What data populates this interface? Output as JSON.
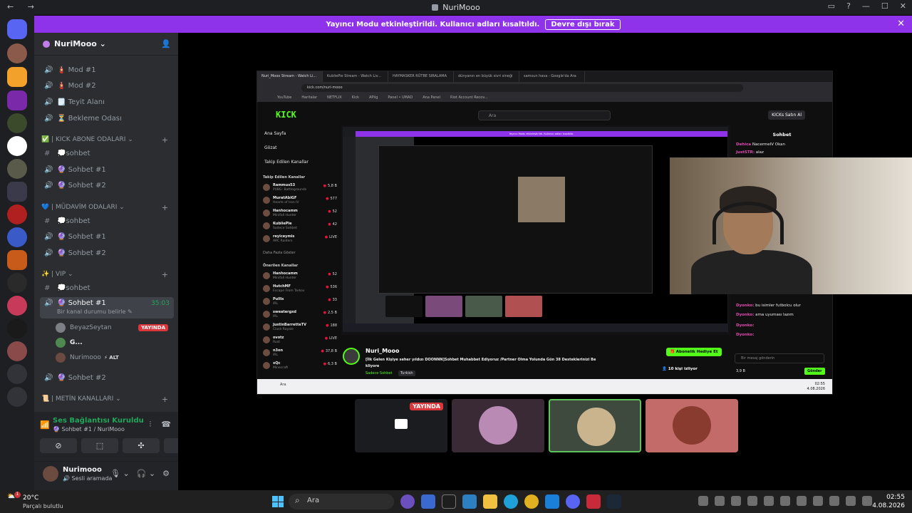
{
  "titlebar": {
    "title": "NuriMooo",
    "nav": "← →",
    "controls": [
      "▭",
      "?",
      "—",
      "☐",
      "✕"
    ]
  },
  "banner": {
    "text": "Yayıncı Modu etkinleştirildi. Kullanıcı adları kısaltıldı.",
    "button": "Devre dışı bırak",
    "close": "✕"
  },
  "server": {
    "name": "NuriMooo ⌄"
  },
  "channels": {
    "top": [
      {
        "icon": "🔊",
        "label": "🧯 Mod #1"
      },
      {
        "icon": "🔊",
        "label": "🧯 Mod #2"
      },
      {
        "icon": "🔊",
        "label": "🗒️ Teyit Alanı"
      },
      {
        "icon": "🔊",
        "label": "⏳ Bekleme Odası"
      }
    ],
    "cat1": "✅ | KICK ABONE ODALARI ⌄",
    "cat1_items": [
      {
        "icon": "#",
        "label": "💭sohbet"
      },
      {
        "icon": "🔊",
        "label": "🔮 Sohbet #1"
      },
      {
        "icon": "🔊",
        "label": "🔮 Sohbet #2"
      }
    ],
    "cat2": "💙 | MÜDAVİM ODALARI ⌄",
    "cat2_items": [
      {
        "icon": "#",
        "label": "💭sohbet"
      },
      {
        "icon": "🔊",
        "label": "🔮 Sohbet #1"
      },
      {
        "icon": "🔊",
        "label": "🔮 Sohbet #2"
      }
    ],
    "cat3": "✨ | VIP ⌄",
    "cat3_items": [
      {
        "icon": "#",
        "label": "💭sohbet"
      }
    ],
    "active": {
      "label": "🔮 Sohbet #1",
      "time": "35:03",
      "status": "Bir kanal durumu belirle ✎"
    },
    "voice_users": [
      {
        "name": "BeyazSeytan",
        "live": "YAYINDA",
        "color": "#7d7f86"
      },
      {
        "name": "G...",
        "color": "#4e8a4f"
      },
      {
        "name": "Nurimooo",
        "alt": "⚡ ALT",
        "color": "#6b4a3f"
      }
    ],
    "after": {
      "icon": "🔊",
      "label": "🔮 Sohbet #2"
    },
    "cat4": "📜 | METİN KANALLARI ⌄",
    "plus": "+"
  },
  "voice": {
    "title": "Ses Bağlantısı Kuruldu",
    "sub": "🔮 Sohbet #1 / NuriMooo",
    "buttons": [
      "⊘",
      "⬚",
      "✣",
      "✹"
    ],
    "controls": [
      "⫶",
      "☎"
    ]
  },
  "user": {
    "name": "Nurimooo",
    "status": "🔊 Sesli aramada",
    "controls": [
      "🎙 ⌄",
      "🎧 ⌄",
      "⚙"
    ]
  },
  "stream": {
    "tabs": [
      "Nuri_Mooo Stream - Watch Li...",
      "KubliePie Stream - Watch Liv...",
      "HAYMASKER RÜTBE SIRALAMA",
      "dünyanın en büyük sivri sineği",
      "samsun hava - Google'da Ara"
    ],
    "url": "kick.com/nuri-mooo",
    "bookmarks": [
      "YouTube",
      "Haritalar",
      "NETFLIX",
      "Kick",
      "APlig",
      "Panel • UMAD",
      "Ana Panel",
      "Riot Account Recov..."
    ],
    "kick_logo": "KICK",
    "search": "Ara",
    "buy": "KICKs Satın Al",
    "side_items": [
      "Ana Sayfa",
      "Gözat",
      "Takip Edilen Kanallar"
    ],
    "followed_header": "Takip Edilen Kanallar",
    "followed": [
      {
        "name": "Rammus53",
        "game": "PUBG: Battlegrounds",
        "viewers": "5,8 B"
      },
      {
        "name": "MuratAbiGF",
        "game": "Hearts of Iron IV",
        "viewers": "577"
      },
      {
        "name": "Hanhocamm",
        "game": "Minifall Hunter",
        "viewers": "52"
      },
      {
        "name": "KubliePie",
        "game": "Sadece Sohbet",
        "viewers": "42"
      },
      {
        "name": "reyiceymis",
        "game": "ARC Raiders",
        "viewers": "LIVE"
      }
    ],
    "more": "Daha Fazla Göster",
    "suggested_header": "Önerilen Kanallar",
    "suggested": [
      {
        "name": "Hanhocamm",
        "game": "Minifall Hunter",
        "viewers": "52"
      },
      {
        "name": "HutchMF",
        "game": "Escape From Tarkov",
        "viewers": "536"
      },
      {
        "name": "Pullis",
        "game": "IRL",
        "viewers": "33"
      },
      {
        "name": "sweatergxd",
        "game": "IRL",
        "viewers": "2,5 B"
      },
      {
        "name": "JustinBarretteTV",
        "game": "Clash Royale",
        "viewers": "188"
      },
      {
        "name": "ovotz",
        "game": "Rust",
        "viewers": "LIVE"
      },
      {
        "name": "n3on",
        "game": "IRL",
        "viewers": "37,8 B"
      },
      {
        "name": "xQc",
        "game": "Minecraft",
        "viewers": "6,3 B"
      }
    ],
    "streamer": "Nuri_Mooo",
    "stream_title": "[İlk Gelen Kişiye seher yıldızı DOONNN]Sohbet Muhabbet Ediyoruz /Partner Olma Yolunda Gün 38 Desteklerinizi Be kliyore",
    "category": "Sadece Sohbet",
    "language": "Turkish",
    "gift": "🎁 Abonelik Hediye Et",
    "watching": "👤 10 kişi izliyor",
    "chat_title": "Sohbet",
    "chat_msgs": [
      {
        "user": "Dehica",
        "text": "  NacermeIV   Okan"
      },
      {
        "user": "JustSTR:",
        "text": "alaz"
      },
      {
        "user": "Dyonko:",
        "text": "bu isimler futbolcu olur"
      },
      {
        "user": "Dyonko:",
        "text": "ama uyuması lazım"
      },
      {
        "user": "Dyonko:",
        "text": ""
      },
      {
        "user": "Dyonko:",
        "text": ""
      }
    ],
    "chat_input": "Bir mesaj gönderin",
    "kicks": "3,9 B",
    "send": "Gönder",
    "win_search": "Ara",
    "win_time": "02:55",
    "win_date": "4.08.2026",
    "nested_banner": "Yayıncı Modu etkinleştirildi. Kullanıcı adları kısaltıldı."
  },
  "tiles": [
    {
      "type": "screen",
      "live": "YAYINDA",
      "bg": "#1b1c1f"
    },
    {
      "type": "avatar",
      "bg": "#3a2a35",
      "pic": "#b98ab4"
    },
    {
      "type": "avatar",
      "bg": "#3f4a3e",
      "pic": "#c9b48e",
      "border": "#5ec35a"
    },
    {
      "type": "avatar",
      "bg": "#c26b68",
      "pic": "#8a3b2f"
    }
  ],
  "taskbar": {
    "weather_temp": "20°C",
    "weather_desc": "Parçalı bulutlu",
    "weather_badge": "1",
    "search": "Ara",
    "time": "02:55",
    "date": "4.08.2026"
  },
  "colors": {
    "accent": "#8e33ea",
    "kick_green": "#53fc18",
    "live_red": "#da373c",
    "voice_green": "#23a55a"
  }
}
